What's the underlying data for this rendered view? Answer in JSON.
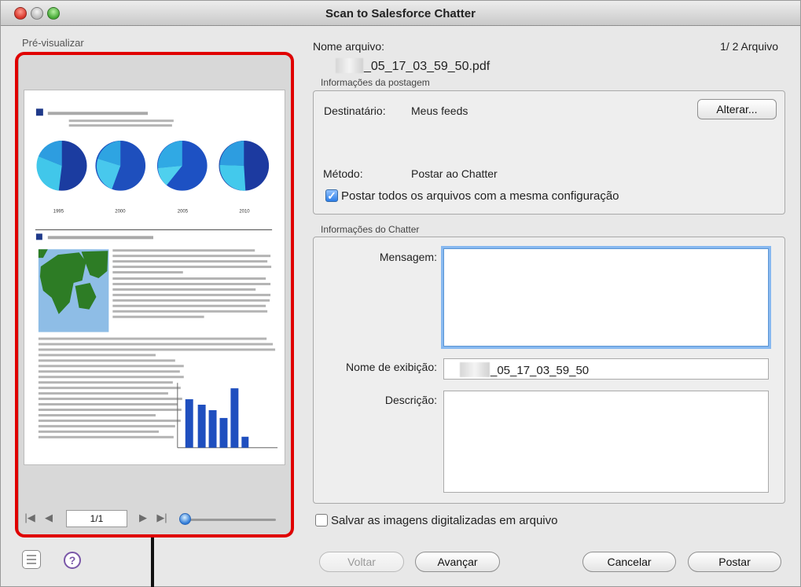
{
  "window": {
    "title": "Scan to Salesforce Chatter"
  },
  "preview": {
    "title": "Pré-visualizar",
    "page_indicator": "1/1",
    "chart_years": [
      "1995",
      "2000",
      "2005",
      "2010"
    ]
  },
  "file": {
    "label": "Nome arquivo:",
    "name_suffix": "_05_17_03_59_50.pdf",
    "count": "1/  2 Arquivo"
  },
  "post_info": {
    "title": "Informações da postagem",
    "recipient_label": "Destinatário:",
    "recipient_value": "Meus feeds",
    "change_button": "Alterar...",
    "method_label": "Método:",
    "method_value": "Postar ao Chatter",
    "same_settings_label": "Postar todos os arquivos com a mesma configuração",
    "same_settings_checked": true
  },
  "chatter_info": {
    "title": "Informações do Chatter",
    "message_label": "Mensagem:",
    "message_value": "",
    "display_name_label": "Nome de exibição:",
    "display_name_suffix": "_05_17_03_59_50",
    "description_label": "Descrição:",
    "description_value": ""
  },
  "footer": {
    "save_images_label": "Salvar as imagens digitalizadas em arquivo",
    "back_button": "Voltar",
    "next_button": "Avançar",
    "cancel_button": "Cancelar",
    "post_button": "Postar"
  },
  "colors": {
    "highlight": "#e00000",
    "chart_blue": "#1f4fbf",
    "dark_navy": "#142d88",
    "checkbox_blue": "#2c7ee8"
  },
  "icons": {
    "list": "list-view-icon",
    "help": "question-icon",
    "first": "first-page-icon",
    "previous": "previous-page-icon",
    "next": "next-page-icon",
    "last": "last-page-icon"
  }
}
